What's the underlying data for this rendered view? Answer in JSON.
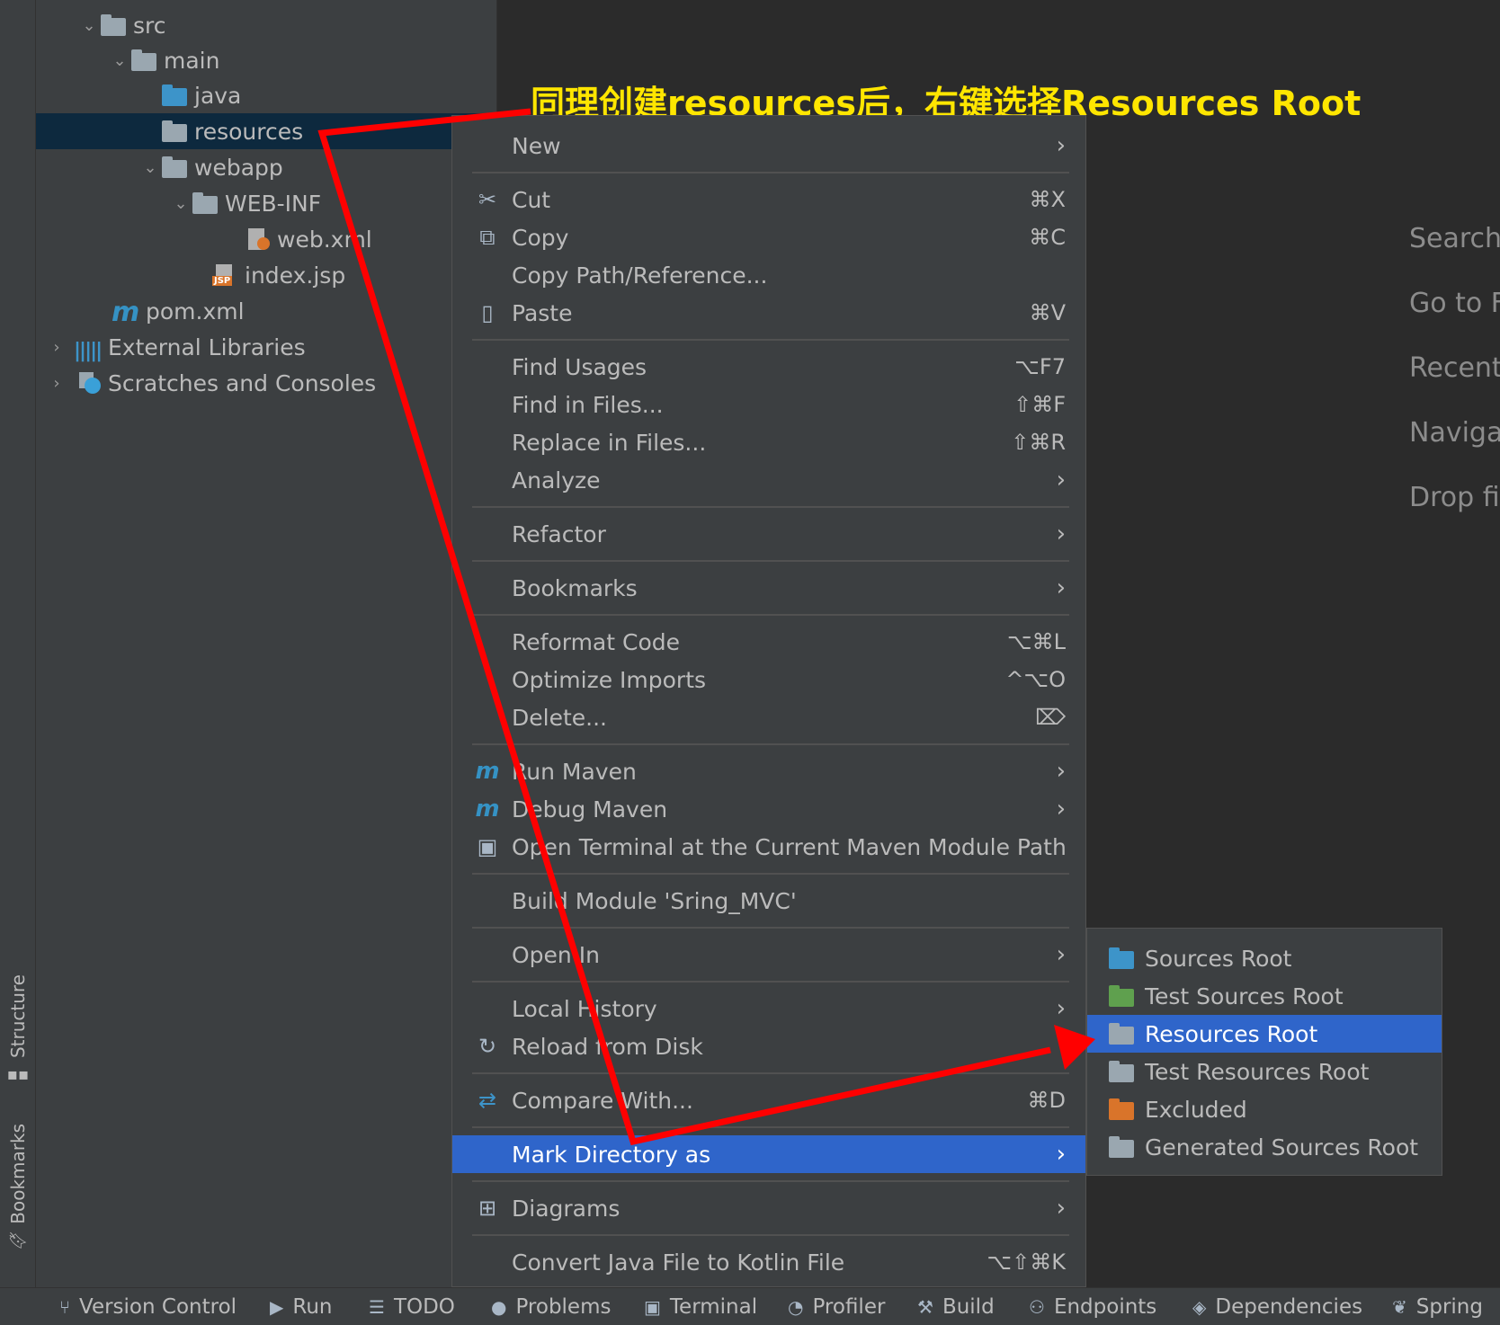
{
  "sidebar": {
    "structure_label": "Structure",
    "bookmarks_label": "Bookmarks"
  },
  "project_tree": [
    {
      "label": "src",
      "icon": "folder-icon",
      "expanded": true
    },
    {
      "label": "main",
      "icon": "folder-icon",
      "expanded": true
    },
    {
      "label": "java",
      "icon": "source-folder-icon"
    },
    {
      "label": "resources",
      "icon": "folder-icon",
      "selected": true
    },
    {
      "label": "webapp",
      "icon": "web-folder-icon",
      "expanded": true
    },
    {
      "label": "WEB-INF",
      "icon": "folder-icon",
      "expanded": true
    },
    {
      "label": "web.xml",
      "icon": "xml-file-icon"
    },
    {
      "label": "index.jsp",
      "icon": "jsp-file-icon"
    },
    {
      "label": "pom.xml",
      "icon": "maven-icon"
    },
    {
      "label": "External Libraries",
      "icon": "libraries-icon",
      "expanded": false
    },
    {
      "label": "Scratches and Consoles",
      "icon": "scratches-icon",
      "expanded": false
    }
  ],
  "annotation": {
    "text": "同理创建resources后，右键选择Resources Root",
    "color": "#ffe600"
  },
  "editor_hints": [
    "Search",
    "Go to F",
    "Recent",
    "Naviga",
    "Drop fi"
  ],
  "context_menu": {
    "items": [
      {
        "label": "New",
        "submenu": true
      },
      {
        "label": "Cut",
        "shortcut": "⌘X",
        "icon": "scissors-icon"
      },
      {
        "label": "Copy",
        "shortcut": "⌘C",
        "icon": "copy-icon"
      },
      {
        "label": "Copy Path/Reference..."
      },
      {
        "label": "Paste",
        "shortcut": "⌘V",
        "icon": "clipboard-icon"
      },
      {
        "label": "Find Usages",
        "shortcut": "⌥F7"
      },
      {
        "label": "Find in Files...",
        "shortcut": "⇧⌘F"
      },
      {
        "label": "Replace in Files...",
        "shortcut": "⇧⌘R"
      },
      {
        "label": "Analyze",
        "submenu": true
      },
      {
        "label": "Refactor",
        "submenu": true
      },
      {
        "label": "Bookmarks",
        "submenu": true
      },
      {
        "label": "Reformat Code",
        "shortcut": "⌥⌘L"
      },
      {
        "label": "Optimize Imports",
        "shortcut": "^⌥O"
      },
      {
        "label": "Delete...",
        "shortcut": "⌦"
      },
      {
        "label": "Run Maven",
        "submenu": true,
        "icon": "maven-run-icon"
      },
      {
        "label": "Debug Maven",
        "submenu": true,
        "icon": "maven-debug-icon"
      },
      {
        "label": "Open Terminal at the Current Maven Module Path",
        "icon": "maven-terminal-icon"
      },
      {
        "label": "Build Module 'Sring_MVC'"
      },
      {
        "label": "Open In",
        "submenu": true
      },
      {
        "label": "Local History",
        "submenu": true
      },
      {
        "label": "Reload from Disk",
        "icon": "reload-icon"
      },
      {
        "label": "Compare With...",
        "shortcut": "⌘D",
        "icon": "compare-icon"
      },
      {
        "label": "Mark Directory as",
        "submenu": true,
        "active": true
      },
      {
        "label": "Diagrams",
        "submenu": true,
        "icon": "diagrams-icon"
      },
      {
        "label": "Convert Java File to Kotlin File",
        "shortcut": "⌥⇧⌘K"
      }
    ]
  },
  "mark_directory_submenu": [
    {
      "label": "Sources Root",
      "icon": "sources-root-icon",
      "color": "#3d94c9"
    },
    {
      "label": "Test Sources Root",
      "icon": "test-sources-root-icon",
      "color": "#5fa04e"
    },
    {
      "label": "Resources Root",
      "icon": "resources-root-icon",
      "color": "#9aa7b0",
      "active": true
    },
    {
      "label": "Test Resources Root",
      "icon": "test-resources-root-icon",
      "color": "#9aa7b0"
    },
    {
      "label": "Excluded",
      "icon": "excluded-folder-icon",
      "color": "#d9742a"
    },
    {
      "label": "Generated Sources Root",
      "icon": "generated-sources-root-icon",
      "color": "#9aa7b0"
    }
  ],
  "status_bar": [
    {
      "label": "Version Control",
      "icon": "branch-icon"
    },
    {
      "label": "Run",
      "icon": "play-icon"
    },
    {
      "label": "TODO",
      "icon": "list-icon"
    },
    {
      "label": "Problems",
      "icon": "problems-icon"
    },
    {
      "label": "Terminal",
      "icon": "terminal-icon"
    },
    {
      "label": "Profiler",
      "icon": "profiler-icon"
    },
    {
      "label": "Build",
      "icon": "hammer-icon"
    },
    {
      "label": "Endpoints",
      "icon": "endpoints-icon"
    },
    {
      "label": "Dependencies",
      "icon": "dependencies-icon"
    },
    {
      "label": "Spring",
      "icon": "spring-icon"
    }
  ],
  "colors": {
    "selection": "#2f65ca",
    "tree_selection": "#0d293e",
    "arrow": "#ff0000"
  }
}
